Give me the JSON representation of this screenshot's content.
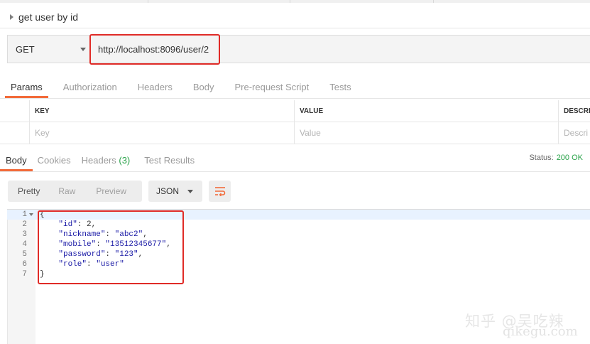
{
  "request": {
    "name": "get user by id",
    "method": "GET",
    "url": "http://localhost:8096/user/2"
  },
  "request_tabs": [
    "Params",
    "Authorization",
    "Headers",
    "Body",
    "Pre-request Script",
    "Tests"
  ],
  "params_table": {
    "headers": [
      "KEY",
      "VALUE",
      "DESCRI"
    ],
    "placeholders": [
      "Key",
      "Value",
      "Descri"
    ]
  },
  "response_tabs": {
    "body": "Body",
    "cookies": "Cookies",
    "headers": "Headers",
    "headers_count": "(3)",
    "test_results": "Test Results"
  },
  "status": {
    "label": "Status:",
    "value": "200 OK"
  },
  "view_modes": [
    "Pretty",
    "Raw",
    "Preview"
  ],
  "format": "JSON",
  "code_lines": [
    {
      "n": "1",
      "text": "{"
    },
    {
      "n": "2",
      "key": "\"id\"",
      "val": "2",
      "end": ","
    },
    {
      "n": "3",
      "key": "\"nickname\"",
      "val": "\"abc2\"",
      "end": ","
    },
    {
      "n": "4",
      "key": "\"mobile\"",
      "val": "\"13512345677\"",
      "end": ","
    },
    {
      "n": "5",
      "key": "\"password\"",
      "val": "\"123\"",
      "end": ","
    },
    {
      "n": "6",
      "key": "\"role\"",
      "val": "\"user\"",
      "end": ""
    },
    {
      "n": "7",
      "text": "}"
    }
  ],
  "watermark": {
    "zh": "知乎 @吴吃辣",
    "site": "qikegu.com"
  },
  "colors": {
    "accent": "#f26b3a",
    "ok": "#2aa34a",
    "highlight_box": "#e02b27",
    "json_string": "#1a1aa6"
  }
}
